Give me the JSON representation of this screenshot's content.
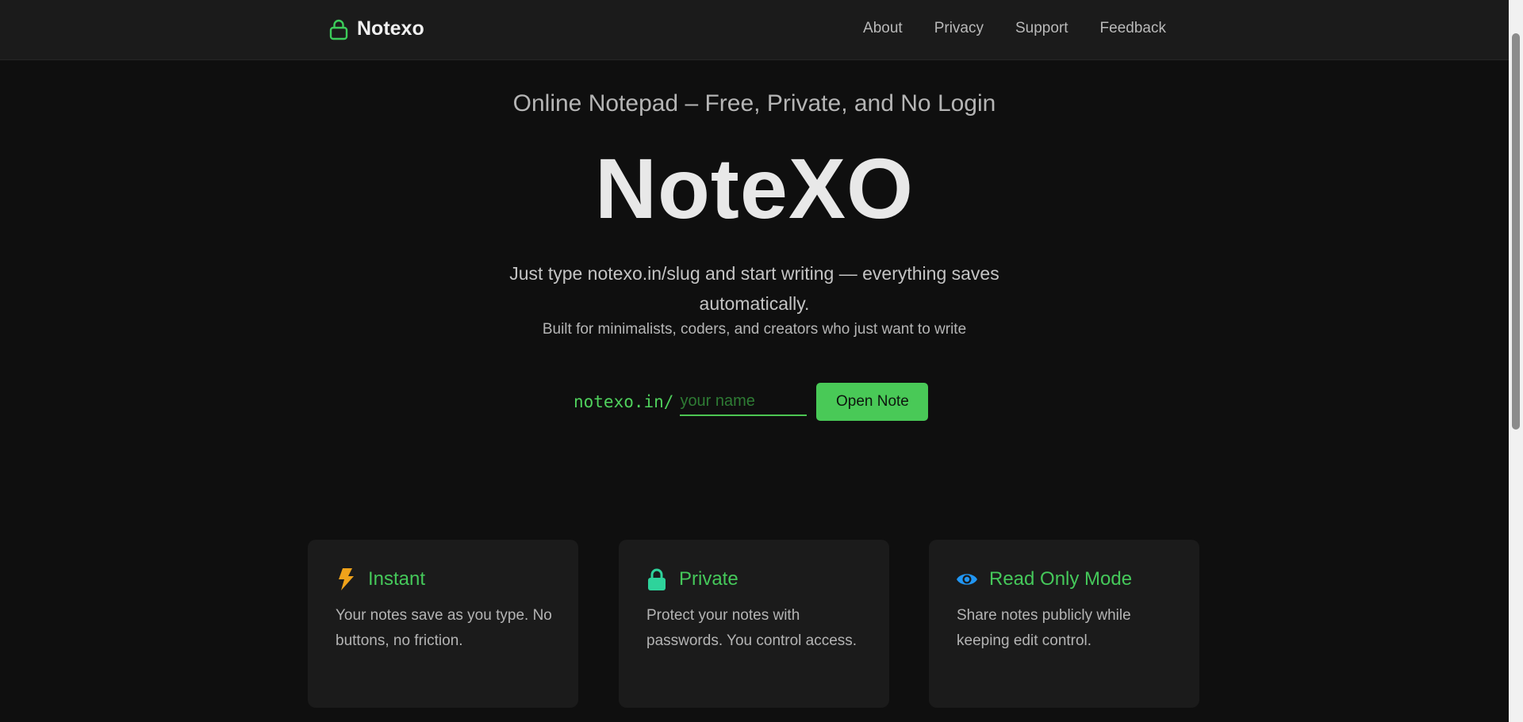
{
  "header": {
    "brand": "Notexo",
    "nav": [
      "About",
      "Privacy",
      "Support",
      "Feedback"
    ]
  },
  "hero": {
    "tagline": "Online Notepad – Free, Private, and No Login",
    "logo": "NoteXO",
    "lead": "Just type notexo.in/slug and start writing — everything saves automatically.",
    "sublead": "Built for minimalists, coders, and creators who just want to write"
  },
  "form": {
    "prefix": "notexo.in/",
    "placeholder": "your name",
    "value": "",
    "button": "Open Note"
  },
  "features": [
    {
      "icon": "bolt-icon",
      "title": "Instant",
      "text": "Your notes save as you type. No buttons, no friction."
    },
    {
      "icon": "lock-icon",
      "title": "Private",
      "text": "Protect your notes with passwords. You control access."
    },
    {
      "icon": "eye-icon",
      "title": "Read Only Mode",
      "text": "Share notes publicly while keeping edit control."
    }
  ],
  "colors": {
    "accent": "#49c957",
    "background": "#0f0f0f",
    "surface": "#1b1b1b",
    "bolt": "#f0a21a",
    "lock": "#2ed39b",
    "eye": "#2196f3"
  }
}
